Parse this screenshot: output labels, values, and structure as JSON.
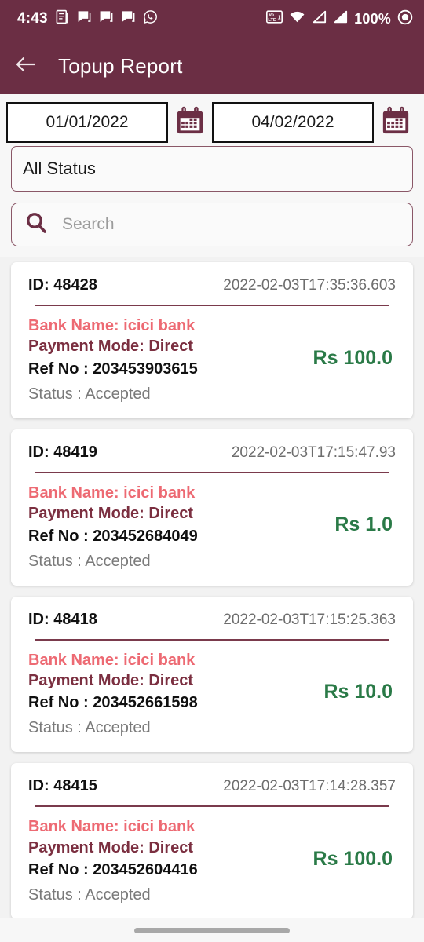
{
  "theme": {
    "primary": "#6B2E44",
    "accent_red": "#ED6A73",
    "accent_maroon": "#7B2F40",
    "amount_green": "#2A7A47",
    "page_bg": "#F2F2F2"
  },
  "status_bar": {
    "time": "4:43",
    "battery": "100%",
    "left_icons": [
      "document-icon",
      "message-icon",
      "message-icon",
      "message-icon",
      "whatsapp-icon"
    ],
    "right_icons": [
      "volte-icon",
      "wifi-icon",
      "signal-icon",
      "signal-icon",
      "recording-icon"
    ]
  },
  "app_bar": {
    "back_icon": "back-arrow-icon",
    "title": "Topup Report"
  },
  "filters": {
    "from_date": "01/01/2022",
    "to_date": "04/02/2022",
    "from_calendar_icon": "calendar-icon",
    "to_calendar_icon": "calendar-icon",
    "status_selected": "All Status",
    "search_icon": "search-icon",
    "search_value": "",
    "search_placeholder": "Search"
  },
  "transactions": [
    {
      "id_label": "ID: 48428",
      "date": "2022-02-03T17:35:36.603",
      "bank": "Bank Name: icici bank",
      "payment_mode": "Payment Mode: Direct",
      "ref_no": "Ref No : 203453903615",
      "status": "Status : Accepted",
      "amount": "Rs 100.0"
    },
    {
      "id_label": "ID: 48419",
      "date": "2022-02-03T17:15:47.93",
      "bank": "Bank Name: icici bank",
      "payment_mode": "Payment Mode: Direct",
      "ref_no": "Ref No : 203452684049",
      "status": "Status : Accepted",
      "amount": "Rs 1.0"
    },
    {
      "id_label": "ID: 48418",
      "date": "2022-02-03T17:15:25.363",
      "bank": "Bank Name: icici bank",
      "payment_mode": "Payment Mode: Direct",
      "ref_no": "Ref No : 203452661598",
      "status": "Status : Accepted",
      "amount": "Rs 10.0"
    },
    {
      "id_label": "ID: 48415",
      "date": "2022-02-03T17:14:28.357",
      "bank": "Bank Name: icici bank",
      "payment_mode": "Payment Mode: Direct",
      "ref_no": "Ref No : 203452604416",
      "status": "Status : Accepted",
      "amount": "Rs 100.0"
    }
  ],
  "nav_bar": {
    "handle": "home-gesture-handle"
  }
}
